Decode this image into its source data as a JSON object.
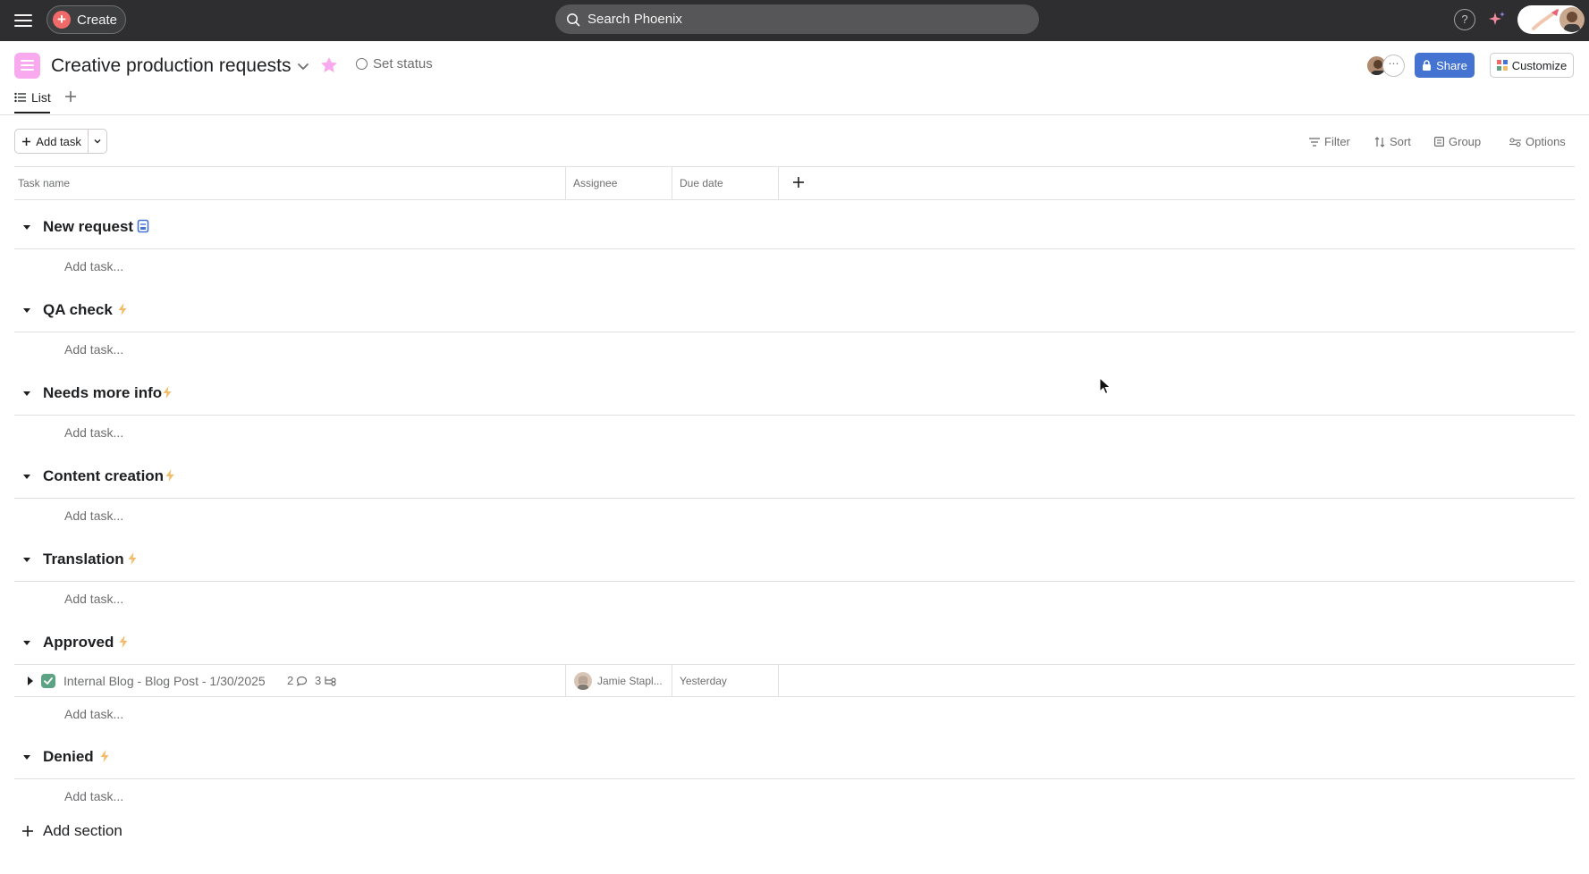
{
  "topbar": {
    "create_label": "Create",
    "search_placeholder": "Search Phoenix",
    "help_label": "?"
  },
  "project": {
    "title": "Creative production requests",
    "set_status_label": "Set status",
    "share_label": "Share",
    "customize_label": "Customize",
    "member_more": "⋯"
  },
  "tabs": {
    "list_label": "List"
  },
  "toolbar": {
    "add_task_label": "Add task",
    "filter_label": "Filter",
    "sort_label": "Sort",
    "group_label": "Group",
    "options_label": "Options"
  },
  "columns": {
    "task_name": "Task name",
    "assignee": "Assignee",
    "due_date": "Due date"
  },
  "sections": [
    {
      "title": "New request",
      "icon": "form-icon",
      "add_task": "Add task..."
    },
    {
      "title": "QA check",
      "icon": "lightning-icon",
      "add_task": "Add task..."
    },
    {
      "title": "Needs more info",
      "icon": "lightning-icon",
      "add_task": "Add task..."
    },
    {
      "title": "Content creation",
      "icon": "lightning-icon",
      "add_task": "Add task..."
    },
    {
      "title": "Translation",
      "icon": "lightning-icon",
      "add_task": "Add task..."
    },
    {
      "title": "Approved",
      "icon": "lightning-icon",
      "add_task": "Add task..."
    },
    {
      "title": "Denied",
      "icon": "lightning-icon",
      "add_task": "Add task..."
    }
  ],
  "task": {
    "name": "Internal Blog - Blog Post - 1/30/2025",
    "comments": "2",
    "subtasks": "3",
    "assignee": "Jamie Stapl...",
    "due_date": "Yesterday",
    "completed": true
  },
  "add_section_label": "Add section",
  "colors": {
    "topbar": "#2e2e30",
    "accent_create": "#f06a6a",
    "share_blue": "#4573d2",
    "project_icon": "#f9aaef",
    "lightning": "#f1bd6c",
    "check_green": "#5da283",
    "form_blue": "#4573d2"
  }
}
